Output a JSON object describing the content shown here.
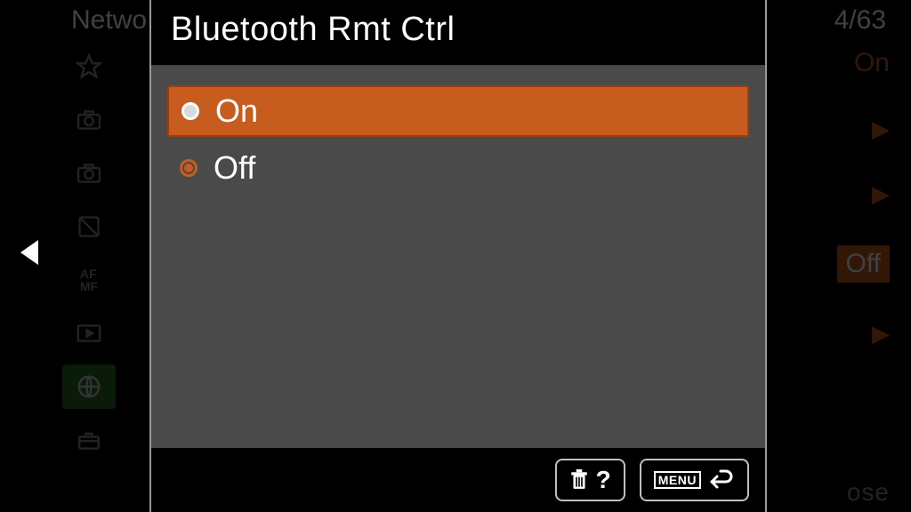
{
  "background": {
    "breadcrumb": "Netwo",
    "page_counter": "4/63",
    "right_values": {
      "on": "On",
      "off": "Off"
    },
    "bottom_fragment": "ose"
  },
  "modal": {
    "title": "Bluetooth Rmt Ctrl",
    "options": [
      {
        "label": "On",
        "selected": true
      },
      {
        "label": "Off",
        "selected": false
      }
    ],
    "footer": {
      "help_symbol": "?",
      "menu_label": "MENU"
    }
  }
}
